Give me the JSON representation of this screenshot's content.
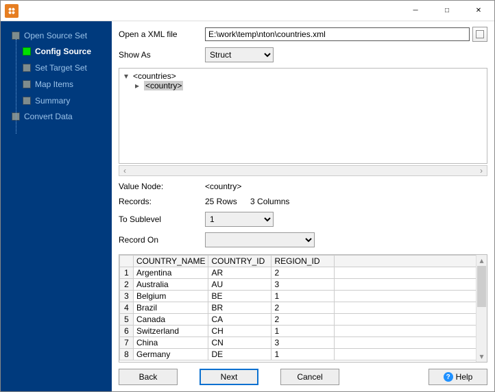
{
  "sidebar": {
    "parent1": "Open Source Set",
    "item_config": "Config Source",
    "item_target": "Set Target Set",
    "item_map": "Map Items",
    "item_summary": "Summary",
    "parent2": "Convert Data"
  },
  "form": {
    "open_label": "Open a XML file",
    "file_path": "E:\\work\\temp\\nton\\countries.xml",
    "show_as_label": "Show As",
    "show_as_value": "Struct",
    "value_node_label": "Value Node:",
    "value_node_value": "<country>",
    "records_label": "Records:",
    "records_rows": "25 Rows",
    "records_cols": "3 Columns",
    "to_sublevel_label": "To Sublevel",
    "to_sublevel_value": "1",
    "record_on_label": "Record On",
    "record_on_value": ""
  },
  "tree": {
    "root": "<countries>",
    "child": "<country>"
  },
  "table": {
    "headers": [
      "COUNTRY_NAME",
      "COUNTRY_ID",
      "REGION_ID"
    ],
    "rows": [
      [
        "Argentina",
        "AR",
        "2"
      ],
      [
        "Australia",
        "AU",
        "3"
      ],
      [
        "Belgium",
        "BE",
        "1"
      ],
      [
        "Brazil",
        "BR",
        "2"
      ],
      [
        "Canada",
        "CA",
        "2"
      ],
      [
        "Switzerland",
        "CH",
        "1"
      ],
      [
        "China",
        "CN",
        "3"
      ],
      [
        "Germany",
        "DE",
        "1"
      ]
    ]
  },
  "buttons": {
    "back": "Back",
    "next": "Next",
    "cancel": "Cancel",
    "help": "Help"
  }
}
